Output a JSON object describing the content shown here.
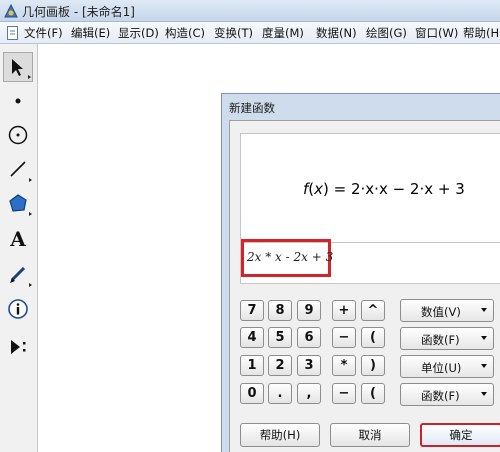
{
  "window": {
    "title": "几何画板 - [未命名1]"
  },
  "menu": {
    "items": [
      "文件(F)",
      "编辑(E)",
      "显示(D)",
      "构造(C)",
      "变换(T)",
      "度量(M)",
      "数据(N)",
      "绘图(G)",
      "窗口(W)",
      "帮助(H)"
    ]
  },
  "toolbox": {
    "tools": [
      "arrow-select-tool",
      "point-tool",
      "compass-tool",
      "straightedge-tool",
      "polygon-tool",
      "text-tool",
      "marker-tool",
      "info-tool",
      "custom-tool"
    ],
    "text_tool_letter": "A"
  },
  "dialog": {
    "title": "新建函数",
    "formula": {
      "prefix": "f",
      "open": "(",
      "var": "x",
      "close": ")",
      "rhs": " = 2·x·x − 2·x + 3"
    },
    "input_value": "2x * x - 2x + 3",
    "keypad": [
      [
        "7",
        "8",
        "9",
        "+",
        "^"
      ],
      [
        "4",
        "5",
        "6",
        "−",
        "("
      ],
      [
        "1",
        "2",
        "3",
        "*",
        ")"
      ],
      [
        "0",
        ".",
        ",",
        "−",
        "("
      ]
    ],
    "side_buttons": [
      "数值(V)",
      "函数(F)",
      "单位(U)",
      "函数(F)"
    ],
    "help_button": "帮助(H)",
    "cancel_button": "取消",
    "ok_button": "确定"
  },
  "colors": {
    "highlight": "#d4232b",
    "dialog_frame": "#cfdcec"
  }
}
